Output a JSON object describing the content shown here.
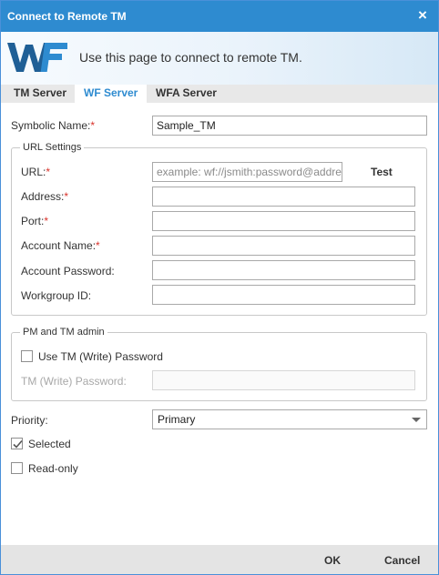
{
  "window": {
    "title": "Connect to Remote TM",
    "close_glyph": "×"
  },
  "banner": {
    "logo_icon": "wf-logo-icon",
    "description": "Use this page to connect to remote TM."
  },
  "tabs": [
    {
      "label": "TM Server",
      "active": false
    },
    {
      "label": "WF Server",
      "active": true
    },
    {
      "label": "WFA Server",
      "active": false
    }
  ],
  "form": {
    "symbolic_name": {
      "label": "Symbolic Name:",
      "required_mark": "*",
      "value": "Sample_TM"
    },
    "url_settings": {
      "legend": "URL Settings",
      "url": {
        "label": "URL:",
        "required_mark": "*",
        "placeholder": "example:  wf://jsmith:password@address"
      },
      "test_label": "Test",
      "address": {
        "label": "Address:",
        "required_mark": "*",
        "value": ""
      },
      "port": {
        "label": "Port:",
        "required_mark": "*",
        "value": ""
      },
      "account_name": {
        "label": "Account Name:",
        "required_mark": "*",
        "value": ""
      },
      "account_password": {
        "label": "Account Password:",
        "value": ""
      },
      "workgroup_id": {
        "label": "Workgroup ID:",
        "value": ""
      }
    },
    "pm_tm_admin": {
      "legend": "PM and TM admin",
      "use_tm_write_password": {
        "label": "Use TM (Write) Password",
        "checked": false
      },
      "tm_write_password": {
        "label": "TM (Write) Password:",
        "value": "",
        "disabled": true
      }
    },
    "priority": {
      "label": "Priority:",
      "selected": "Primary"
    },
    "selected": {
      "label": "Selected",
      "checked": true
    },
    "read_only": {
      "label": "Read-only",
      "checked": false
    }
  },
  "footer": {
    "ok_label": "OK",
    "cancel_label": "Cancel"
  },
  "colors": {
    "accent": "#2e8bd0",
    "required": "#d9322b",
    "footer_bg": "#e4e4e4"
  }
}
